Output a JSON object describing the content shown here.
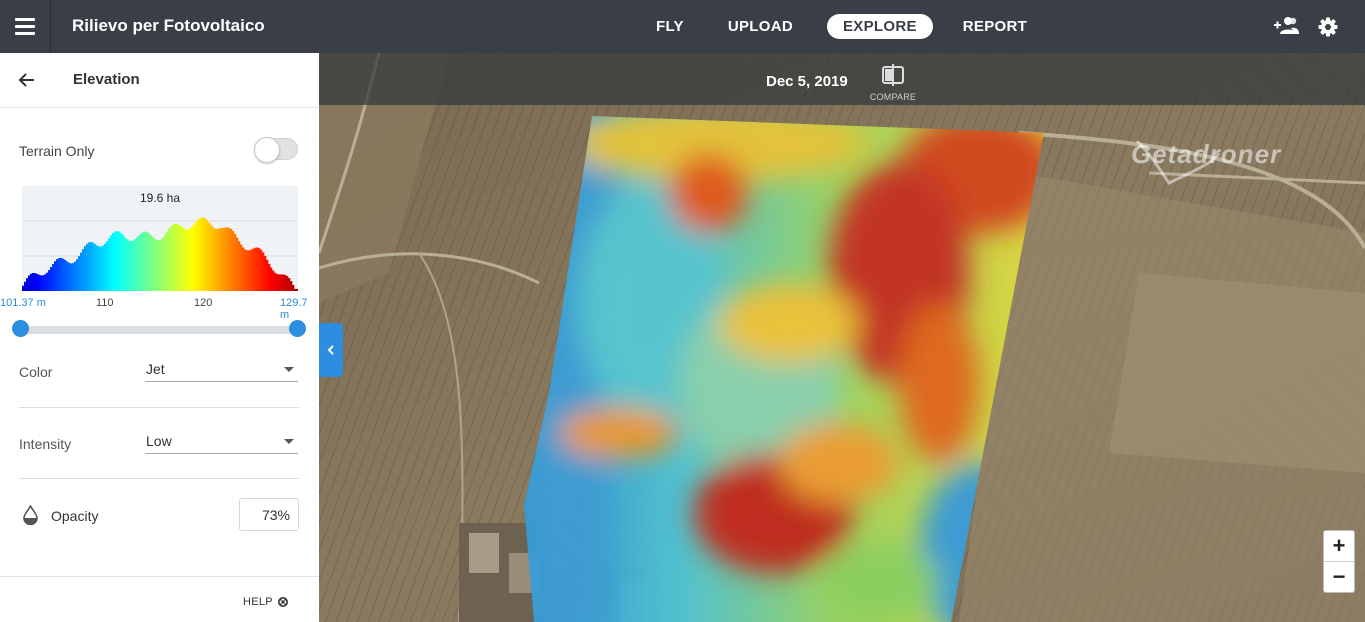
{
  "header": {
    "title": "Rilievo per Fotovoltaico",
    "nav": [
      {
        "label": "FLY",
        "active": false
      },
      {
        "label": "UPLOAD",
        "active": false
      },
      {
        "label": "EXPLORE",
        "active": true
      },
      {
        "label": "REPORT",
        "active": false
      }
    ],
    "icons": [
      "menu-icon",
      "add-user-icon",
      "gear-icon"
    ]
  },
  "sidebar": {
    "title": "Elevation",
    "terrain_only": {
      "label": "Terrain Only",
      "enabled": false
    },
    "histogram": {
      "area_label": "19.6 ha",
      "min_label": "101.37 m",
      "tick_110": "110",
      "tick_120": "120",
      "max_label": "129.7 m",
      "range_min": 101.37,
      "range_max": 129.7
    },
    "color": {
      "label": "Color",
      "value": "Jet"
    },
    "intensity": {
      "label": "Intensity",
      "value": "Low"
    },
    "opacity": {
      "label": "Opacity",
      "value": "73%"
    },
    "help_label": "HELP"
  },
  "map": {
    "date": "Dec 5, 2019",
    "compare_label": "COMPARE",
    "watermark": "Getadroner",
    "zoom_in": "+",
    "zoom_out": "−",
    "accent_color": "#2d8ee0"
  }
}
